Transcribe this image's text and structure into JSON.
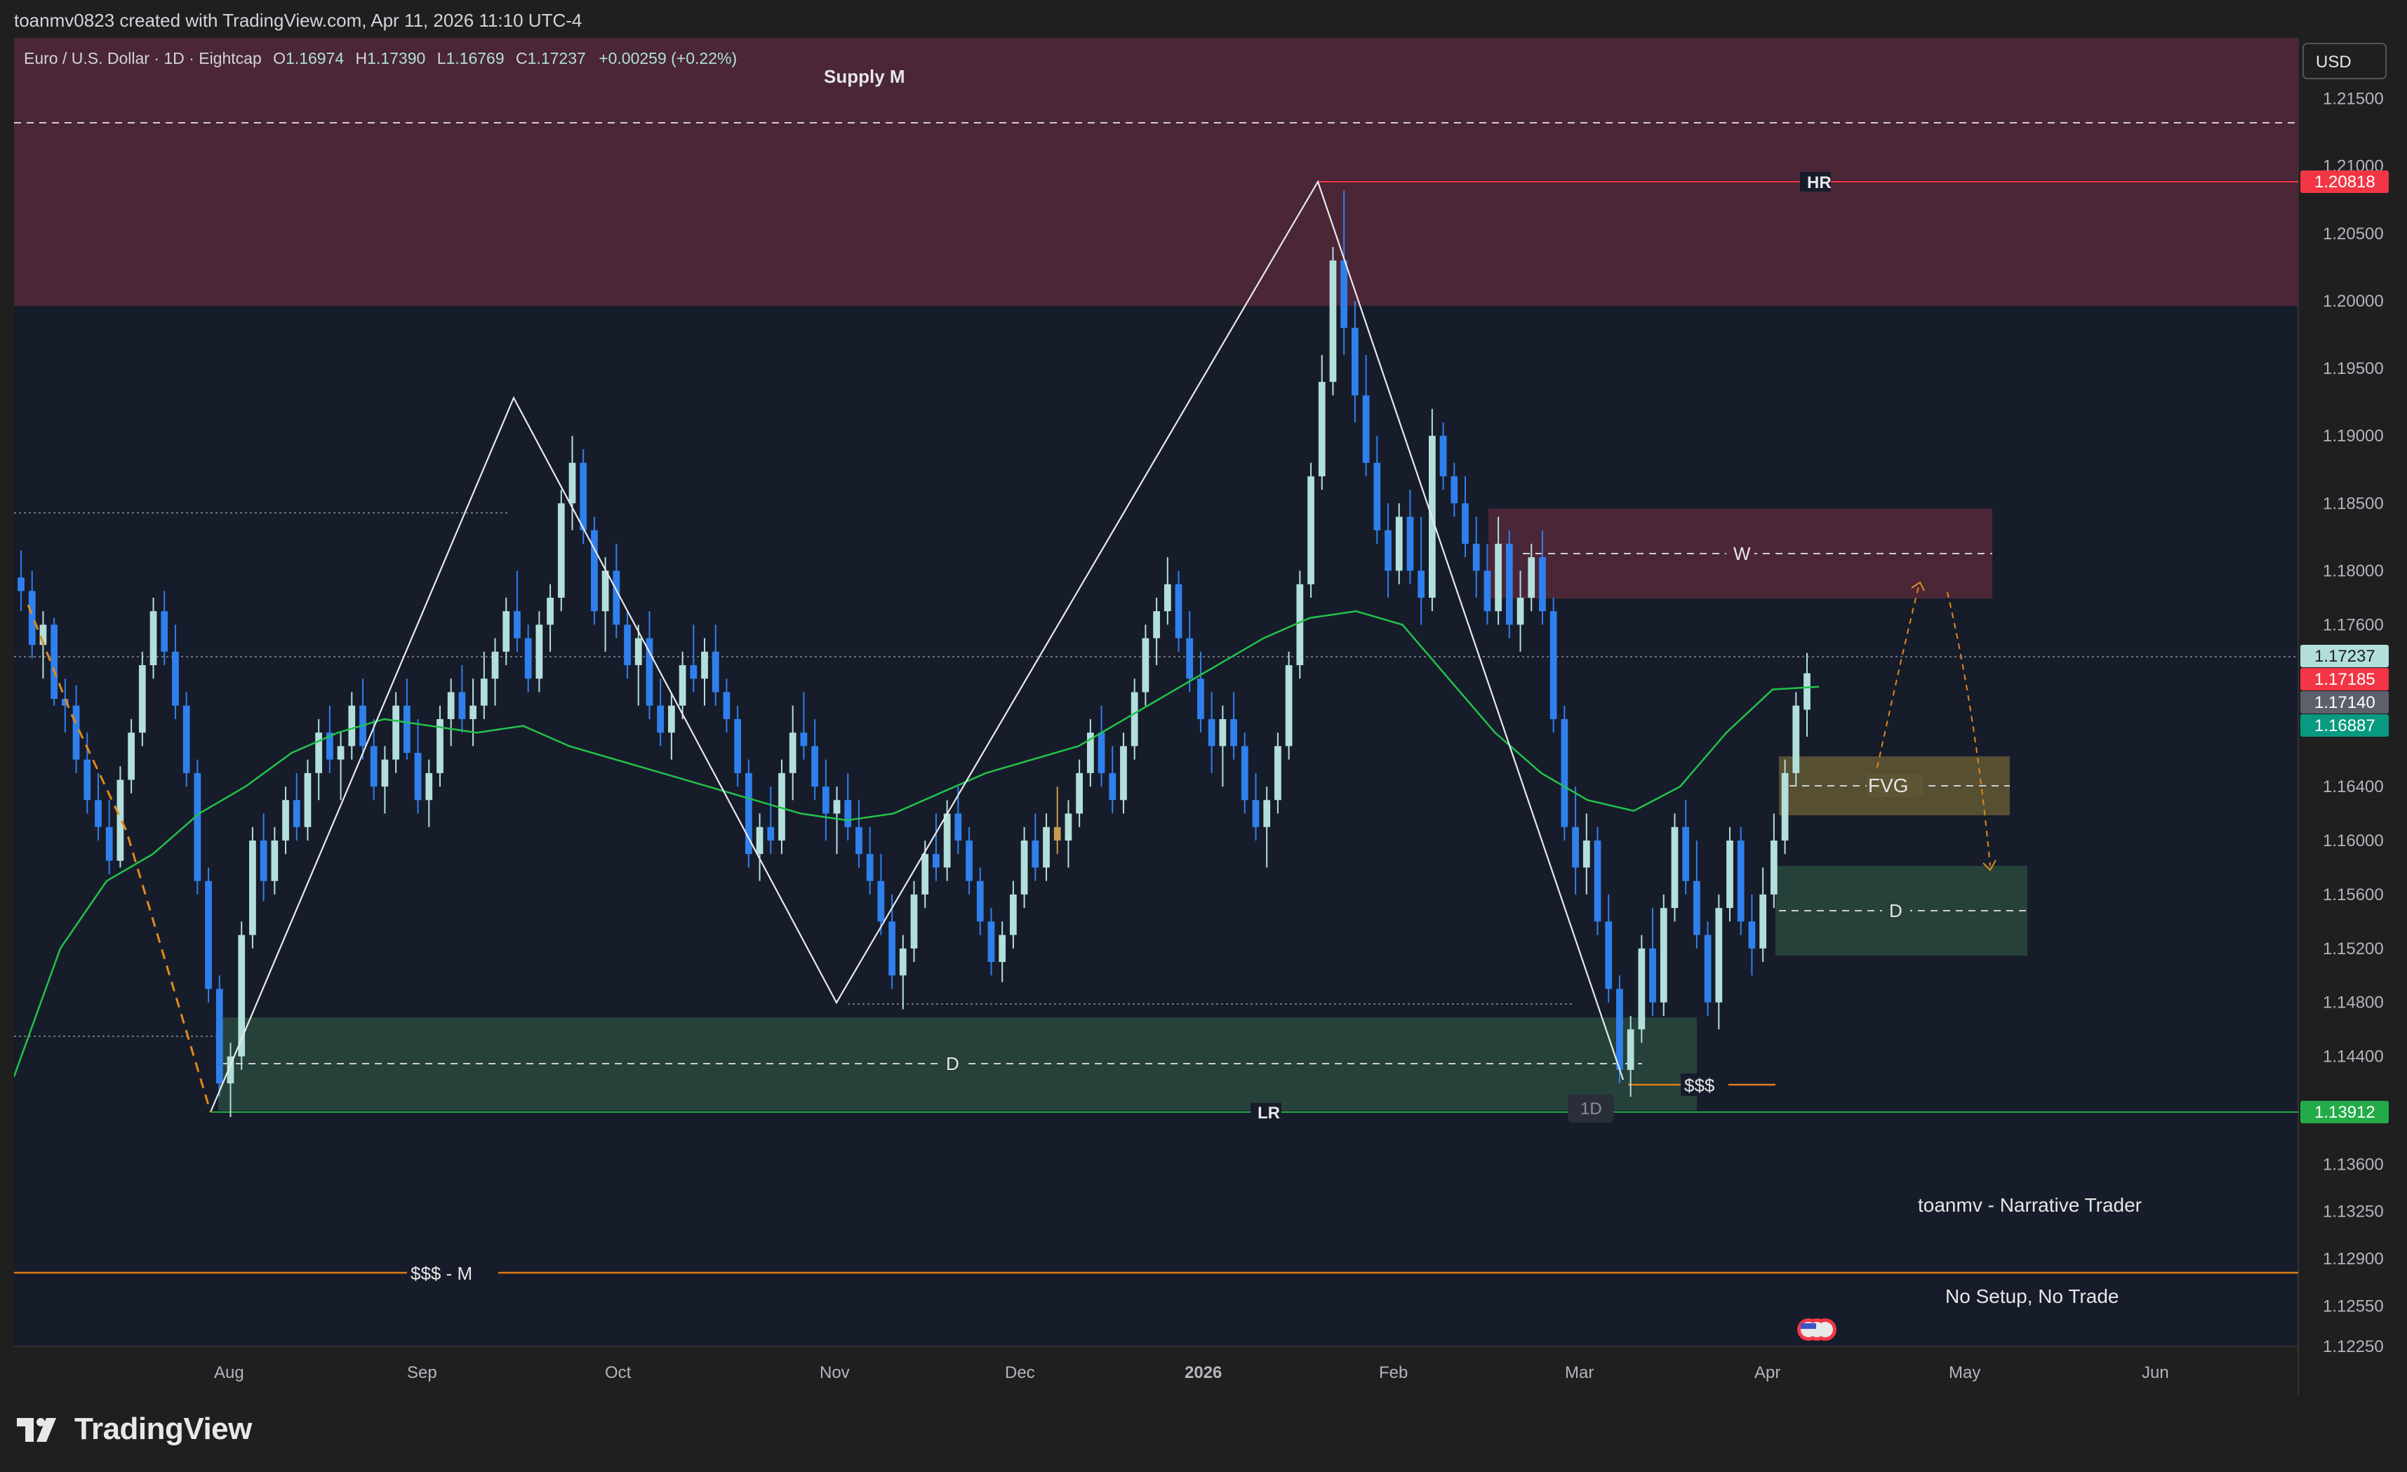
{
  "header": {
    "attribution": "toanmv0823 created with TradingView.com, Apr 11, 2026 11:10 UTC-4"
  },
  "legend": {
    "symbol": "Euro / U.S. Dollar · 1D · Eightcap",
    "open_label": "O",
    "open": "1.16974",
    "high_label": "H",
    "high": "1.17390",
    "low_label": "L",
    "low": "1.16769",
    "close_label": "C",
    "close": "1.17237",
    "change": "+0.00259 (+0.22%)"
  },
  "currency": "USD",
  "brand": "TradingView",
  "colors": {
    "bull": "#b2dfdb",
    "bear": "#2f80ed",
    "doji": "#c59a4f",
    "ema": "#22c34a",
    "supply": "#5a2a3a",
    "demand": "#2a4a3a",
    "fvg": "#5d5533",
    "hr": "#f23645",
    "lr": "#22ab48",
    "liquidity": "#e07b1a"
  },
  "chart_data": {
    "type": "candlestick",
    "title": "Euro / U.S. Dollar · 1D · Eightcap",
    "ylim": [
      1.1225,
      1.2195
    ],
    "x_ticks": [
      "Aug",
      "Sep",
      "Oct",
      "Nov",
      "Dec",
      "2026",
      "Feb",
      "Mar",
      "Apr",
      "May",
      "Jun"
    ],
    "y_ticks": [
      "1.21500",
      "1.21000",
      "1.20500",
      "1.20000",
      "1.19500",
      "1.19000",
      "1.18500",
      "1.18000",
      "1.17600",
      "1.16400",
      "1.16000",
      "1.15600",
      "1.15200",
      "1.14800",
      "1.14400",
      "1.14000",
      "1.13600",
      "1.13250",
      "1.12900",
      "1.12550",
      "1.12250"
    ],
    "price_labels": [
      {
        "value": "1.20818",
        "color": "#f23645"
      },
      {
        "value": "1.17237",
        "color": "#b2dfdb"
      },
      {
        "value": "1.17185",
        "color": "#f23645"
      },
      {
        "value": "1.17140",
        "color": "#5d606b"
      },
      {
        "value": "1.16887",
        "color": "#089981"
      },
      {
        "value": "1.13912",
        "color": "#22ab48"
      }
    ],
    "ohlc": [
      [
        1.1795,
        1.1815,
        1.177,
        1.1785
      ],
      [
        1.1785,
        1.18,
        1.1735,
        1.1745
      ],
      [
        1.1745,
        1.177,
        1.172,
        1.176
      ],
      [
        1.176,
        1.1765,
        1.17,
        1.1705
      ],
      [
        1.1705,
        1.172,
        1.168,
        1.17
      ],
      [
        1.17,
        1.1715,
        1.165,
        1.166
      ],
      [
        1.166,
        1.168,
        1.162,
        1.163
      ],
      [
        1.163,
        1.165,
        1.16,
        1.161
      ],
      [
        1.161,
        1.163,
        1.1575,
        1.1585
      ],
      [
        1.1585,
        1.1655,
        1.158,
        1.1645
      ],
      [
        1.1645,
        1.169,
        1.1635,
        1.168
      ],
      [
        1.168,
        1.174,
        1.167,
        1.173
      ],
      [
        1.173,
        1.178,
        1.172,
        1.177
      ],
      [
        1.177,
        1.1785,
        1.173,
        1.174
      ],
      [
        1.174,
        1.176,
        1.169,
        1.17
      ],
      [
        1.17,
        1.171,
        1.164,
        1.165
      ],
      [
        1.165,
        1.166,
        1.156,
        1.157
      ],
      [
        1.157,
        1.158,
        1.148,
        1.149
      ],
      [
        1.149,
        1.15,
        1.141,
        1.142
      ],
      [
        1.142,
        1.145,
        1.1395,
        1.144
      ],
      [
        1.144,
        1.154,
        1.143,
        1.153
      ],
      [
        1.153,
        1.161,
        1.152,
        1.16
      ],
      [
        1.16,
        1.162,
        1.1555,
        1.157
      ],
      [
        1.157,
        1.161,
        1.156,
        1.16
      ],
      [
        1.16,
        1.164,
        1.159,
        1.163
      ],
      [
        1.163,
        1.165,
        1.16,
        1.161
      ],
      [
        1.161,
        1.166,
        1.16,
        1.165
      ],
      [
        1.165,
        1.169,
        1.163,
        1.168
      ],
      [
        1.168,
        1.17,
        1.165,
        1.166
      ],
      [
        1.166,
        1.168,
        1.163,
        1.167
      ],
      [
        1.167,
        1.171,
        1.166,
        1.17
      ],
      [
        1.17,
        1.172,
        1.166,
        1.167
      ],
      [
        1.167,
        1.169,
        1.163,
        1.164
      ],
      [
        1.164,
        1.167,
        1.162,
        1.166
      ],
      [
        1.166,
        1.171,
        1.165,
        1.17
      ],
      [
        1.17,
        1.172,
        1.166,
        1.1665
      ],
      [
        1.1665,
        1.169,
        1.162,
        1.163
      ],
      [
        1.163,
        1.166,
        1.161,
        1.165
      ],
      [
        1.165,
        1.17,
        1.164,
        1.169
      ],
      [
        1.169,
        1.172,
        1.167,
        1.171
      ],
      [
        1.171,
        1.173,
        1.168,
        1.169
      ],
      [
        1.169,
        1.172,
        1.167,
        1.17
      ],
      [
        1.17,
        1.174,
        1.169,
        1.172
      ],
      [
        1.172,
        1.175,
        1.17,
        1.174
      ],
      [
        1.174,
        1.178,
        1.173,
        1.177
      ],
      [
        1.177,
        1.18,
        1.174,
        1.175
      ],
      [
        1.175,
        1.176,
        1.171,
        1.172
      ],
      [
        1.172,
        1.177,
        1.171,
        1.176
      ],
      [
        1.176,
        1.179,
        1.174,
        1.178
      ],
      [
        1.178,
        1.186,
        1.177,
        1.185
      ],
      [
        1.185,
        1.19,
        1.183,
        1.188
      ],
      [
        1.188,
        1.189,
        1.182,
        1.183
      ],
      [
        1.183,
        1.184,
        1.176,
        1.177
      ],
      [
        1.177,
        1.181,
        1.174,
        1.18
      ],
      [
        1.18,
        1.182,
        1.175,
        1.176
      ],
      [
        1.176,
        1.177,
        1.172,
        1.173
      ],
      [
        1.173,
        1.176,
        1.17,
        1.175
      ],
      [
        1.175,
        1.177,
        1.169,
        1.17
      ],
      [
        1.17,
        1.172,
        1.167,
        1.168
      ],
      [
        1.168,
        1.171,
        1.166,
        1.17
      ],
      [
        1.17,
        1.174,
        1.169,
        1.173
      ],
      [
        1.173,
        1.176,
        1.171,
        1.172
      ],
      [
        1.172,
        1.175,
        1.17,
        1.174
      ],
      [
        1.174,
        1.176,
        1.17,
        1.171
      ],
      [
        1.171,
        1.172,
        1.168,
        1.169
      ],
      [
        1.169,
        1.17,
        1.164,
        1.165
      ],
      [
        1.165,
        1.166,
        1.158,
        1.159
      ],
      [
        1.159,
        1.162,
        1.157,
        1.161
      ],
      [
        1.161,
        1.164,
        1.159,
        1.16
      ],
      [
        1.16,
        1.166,
        1.159,
        1.165
      ],
      [
        1.165,
        1.17,
        1.163,
        1.168
      ],
      [
        1.168,
        1.171,
        1.166,
        1.167
      ],
      [
        1.167,
        1.169,
        1.163,
        1.164
      ],
      [
        1.164,
        1.166,
        1.16,
        1.162
      ],
      [
        1.162,
        1.164,
        1.159,
        1.163
      ],
      [
        1.163,
        1.165,
        1.16,
        1.161
      ],
      [
        1.161,
        1.163,
        1.158,
        1.159
      ],
      [
        1.159,
        1.161,
        1.156,
        1.157
      ],
      [
        1.157,
        1.159,
        1.153,
        1.154
      ],
      [
        1.154,
        1.156,
        1.149,
        1.15
      ],
      [
        1.15,
        1.153,
        1.1475,
        1.152
      ],
      [
        1.152,
        1.157,
        1.151,
        1.156
      ],
      [
        1.156,
        1.16,
        1.155,
        1.159
      ],
      [
        1.159,
        1.162,
        1.157,
        1.158
      ],
      [
        1.158,
        1.163,
        1.157,
        1.162
      ],
      [
        1.162,
        1.164,
        1.159,
        1.16
      ],
      [
        1.16,
        1.161,
        1.156,
        1.157
      ],
      [
        1.157,
        1.158,
        1.153,
        1.154
      ],
      [
        1.154,
        1.155,
        1.15,
        1.151
      ],
      [
        1.151,
        1.154,
        1.1495,
        1.153
      ],
      [
        1.153,
        1.157,
        1.152,
        1.156
      ],
      [
        1.156,
        1.161,
        1.155,
        1.16
      ],
      [
        1.16,
        1.162,
        1.157,
        1.158
      ],
      [
        1.158,
        1.162,
        1.157,
        1.161
      ],
      [
        1.161,
        1.164,
        1.159,
        1.16
      ],
      [
        1.16,
        1.163,
        1.158,
        1.162
      ],
      [
        1.162,
        1.166,
        1.161,
        1.165
      ],
      [
        1.165,
        1.169,
        1.164,
        1.168
      ],
      [
        1.168,
        1.17,
        1.164,
        1.165
      ],
      [
        1.165,
        1.167,
        1.162,
        1.163
      ],
      [
        1.163,
        1.168,
        1.162,
        1.167
      ],
      [
        1.167,
        1.172,
        1.166,
        1.171
      ],
      [
        1.171,
        1.176,
        1.17,
        1.175
      ],
      [
        1.175,
        1.178,
        1.173,
        1.177
      ],
      [
        1.177,
        1.181,
        1.176,
        1.179
      ],
      [
        1.179,
        1.18,
        1.174,
        1.175
      ],
      [
        1.175,
        1.177,
        1.171,
        1.172
      ],
      [
        1.172,
        1.174,
        1.168,
        1.169
      ],
      [
        1.169,
        1.171,
        1.165,
        1.167
      ],
      [
        1.167,
        1.17,
        1.164,
        1.169
      ],
      [
        1.169,
        1.171,
        1.166,
        1.167
      ],
      [
        1.167,
        1.168,
        1.162,
        1.163
      ],
      [
        1.163,
        1.165,
        1.16,
        1.161
      ],
      [
        1.161,
        1.164,
        1.158,
        1.163
      ],
      [
        1.163,
        1.168,
        1.162,
        1.167
      ],
      [
        1.167,
        1.174,
        1.166,
        1.173
      ],
      [
        1.173,
        1.18,
        1.172,
        1.179
      ],
      [
        1.179,
        1.188,
        1.178,
        1.187
      ],
      [
        1.187,
        1.196,
        1.186,
        1.194
      ],
      [
        1.194,
        1.204,
        1.193,
        1.203
      ],
      [
        1.203,
        1.2082,
        1.196,
        1.198
      ],
      [
        1.198,
        1.2,
        1.191,
        1.193
      ],
      [
        1.193,
        1.196,
        1.187,
        1.188
      ],
      [
        1.188,
        1.19,
        1.182,
        1.183
      ],
      [
        1.183,
        1.185,
        1.178,
        1.18
      ],
      [
        1.18,
        1.185,
        1.179,
        1.184
      ],
      [
        1.184,
        1.186,
        1.179,
        1.18
      ],
      [
        1.18,
        1.184,
        1.176,
        1.178
      ],
      [
        1.178,
        1.192,
        1.177,
        1.19
      ],
      [
        1.19,
        1.191,
        1.186,
        1.187
      ],
      [
        1.187,
        1.188,
        1.184,
        1.185
      ],
      [
        1.185,
        1.187,
        1.181,
        1.182
      ],
      [
        1.182,
        1.184,
        1.178,
        1.18
      ],
      [
        1.18,
        1.182,
        1.176,
        1.177
      ],
      [
        1.177,
        1.184,
        1.176,
        1.182
      ],
      [
        1.182,
        1.183,
        1.175,
        1.176
      ],
      [
        1.176,
        1.18,
        1.174,
        1.178
      ],
      [
        1.178,
        1.182,
        1.177,
        1.181
      ],
      [
        1.181,
        1.183,
        1.176,
        1.177
      ],
      [
        1.177,
        1.178,
        1.168,
        1.169
      ],
      [
        1.169,
        1.17,
        1.16,
        1.161
      ],
      [
        1.161,
        1.164,
        1.156,
        1.158
      ],
      [
        1.158,
        1.162,
        1.156,
        1.16
      ],
      [
        1.16,
        1.161,
        1.153,
        1.154
      ],
      [
        1.154,
        1.156,
        1.148,
        1.149
      ],
      [
        1.149,
        1.15,
        1.142,
        1.143
      ],
      [
        1.143,
        1.147,
        1.141,
        1.146
      ],
      [
        1.146,
        1.153,
        1.145,
        1.152
      ],
      [
        1.152,
        1.155,
        1.147,
        1.148
      ],
      [
        1.148,
        1.156,
        1.147,
        1.155
      ],
      [
        1.155,
        1.162,
        1.154,
        1.161
      ],
      [
        1.161,
        1.163,
        1.156,
        1.157
      ],
      [
        1.157,
        1.16,
        1.152,
        1.153
      ],
      [
        1.153,
        1.154,
        1.147,
        1.148
      ],
      [
        1.148,
        1.156,
        1.146,
        1.155
      ],
      [
        1.155,
        1.161,
        1.154,
        1.16
      ],
      [
        1.16,
        1.161,
        1.153,
        1.154
      ],
      [
        1.154,
        1.156,
        1.15,
        1.152
      ],
      [
        1.152,
        1.158,
        1.151,
        1.156
      ],
      [
        1.156,
        1.162,
        1.155,
        1.16
      ],
      [
        1.16,
        1.166,
        1.159,
        1.165
      ],
      [
        1.165,
        1.171,
        1.164,
        1.17
      ],
      [
        1.1697,
        1.1739,
        1.1677,
        1.1724
      ]
    ],
    "ema": [
      1.1425,
      1.152,
      1.157,
      1.159,
      1.162,
      1.164,
      1.1665,
      1.168,
      1.169,
      1.1685,
      1.168,
      1.1685,
      1.167,
      1.166,
      1.165,
      1.164,
      1.163,
      1.162,
      1.1615,
      1.162,
      1.1635,
      1.165,
      1.166,
      1.167,
      1.169,
      1.171,
      1.173,
      1.175,
      1.1765,
      1.177,
      1.176,
      1.172,
      1.168,
      1.165,
      1.163,
      1.1622,
      1.164,
      1.168,
      1.1712,
      1.1714
    ],
    "zones": [
      {
        "label": "Supply M",
        "from": 1.1985,
        "to": 1.219
      },
      {
        "label": "W",
        "from": 1.1765,
        "to": 1.1833
      },
      {
        "label": "FVG",
        "from": 1.1606,
        "to": 1.165
      },
      {
        "label": "D",
        "from": 1.1502,
        "to": 1.157
      },
      {
        "label": "D",
        "from": 1.1391,
        "to": 1.146
      }
    ],
    "levels": [
      {
        "label": "HR",
        "value": 1.20818
      },
      {
        "label": "LR",
        "value": 1.13912
      },
      {
        "label": "$$$ - M",
        "value": 1.128
      },
      {
        "label": "$$$",
        "value": 1.1411
      }
    ],
    "annotations": [
      "toanmv - Narrative Trader",
      "No Setup, No Trade",
      "1D"
    ]
  }
}
